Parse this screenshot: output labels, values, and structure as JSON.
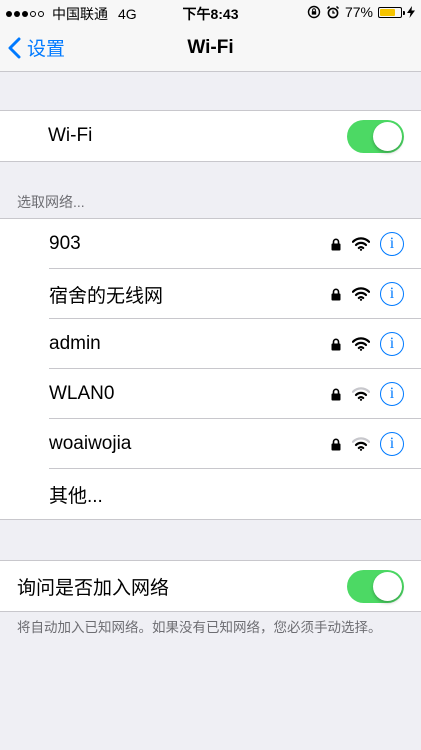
{
  "status_bar": {
    "carrier": "中国联通",
    "network": "4G",
    "time": "下午8:43",
    "battery_percent": "77%",
    "battery_level": 0.77,
    "signal_bars_filled": 3,
    "signal_bars_total": 5
  },
  "nav": {
    "back_label": "设置",
    "title": "Wi-Fi"
  },
  "wifi_toggle": {
    "label": "Wi-Fi",
    "on": true
  },
  "networks_section": {
    "header": "选取网络...",
    "networks": [
      {
        "name": "903",
        "locked": true,
        "signal": "wifi-strong"
      },
      {
        "name": "宿舍的无线网",
        "locked": true,
        "signal": "wifi-strong"
      },
      {
        "name": "admin",
        "locked": true,
        "signal": "wifi-strong"
      },
      {
        "name": "WLAN0",
        "locked": true,
        "signal": "wifi-medium"
      },
      {
        "name": "woaiwojia",
        "locked": true,
        "signal": "wifi-medium"
      }
    ],
    "other": "其他..."
  },
  "ask_join": {
    "label": "询问是否加入网络",
    "on": true,
    "note": "将自动加入已知网络。如果没有已知网络，您必须手动选择。"
  },
  "colors": {
    "accent": "#007aff",
    "toggle_on": "#4cd964",
    "background": "#efeff4",
    "battery": "#f5c400"
  }
}
